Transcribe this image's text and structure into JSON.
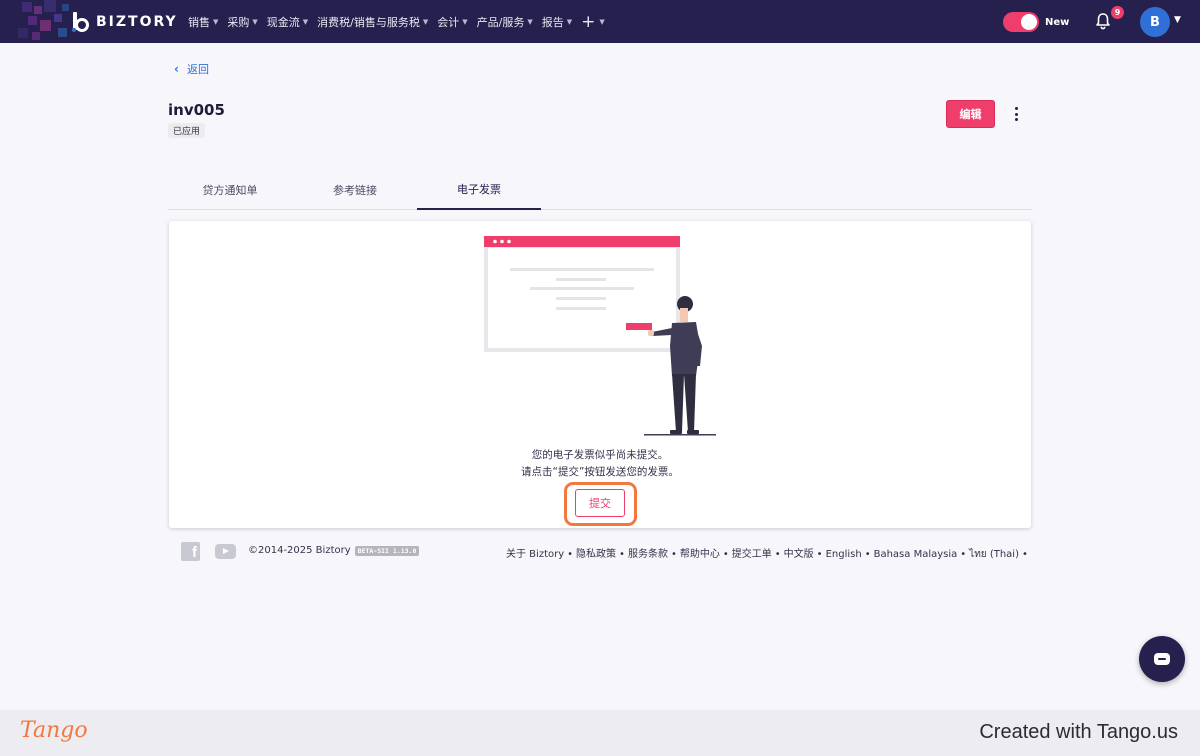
{
  "app": {
    "brand": "BIZTORY",
    "menu": [
      {
        "label": "销售"
      },
      {
        "label": "采购"
      },
      {
        "label": "现金流"
      },
      {
        "label": "消费税/销售与服务税"
      },
      {
        "label": "会计"
      },
      {
        "label": "产品/服务"
      },
      {
        "label": "报告"
      }
    ],
    "add_menu": "+",
    "toggle_label": "New",
    "toggle_on": true,
    "notification_count": "9",
    "avatar_initial": "B",
    "accent_color": "#ef3e6b",
    "nav_color": "#25204d"
  },
  "page": {
    "back_label": "返回",
    "title": "inv005",
    "status": "已应用",
    "edit_label": "编辑",
    "tabs": [
      {
        "label": "贷方通知单",
        "active": false
      },
      {
        "label": "参考链接",
        "active": false
      },
      {
        "label": "电子发票",
        "active": true
      }
    ]
  },
  "einvoice": {
    "message_line1": "您的电子发票似乎尚未提交。",
    "message_line2": "请点击“提交”按钮发送您的发票。",
    "submit_label": "提交"
  },
  "footer": {
    "copyright": "©2014-2025 Biztory",
    "version": "BETA-SII 1.13.0",
    "links": [
      "关于 Biztory",
      "隐私政策",
      "服务条款",
      "帮助中心",
      "提交工单",
      "中文版",
      "English",
      "Bahasa Malaysia",
      "ไทย (Thai)"
    ]
  },
  "watermark": {
    "logo": "Tango",
    "credit": "Created with Tango.us"
  }
}
